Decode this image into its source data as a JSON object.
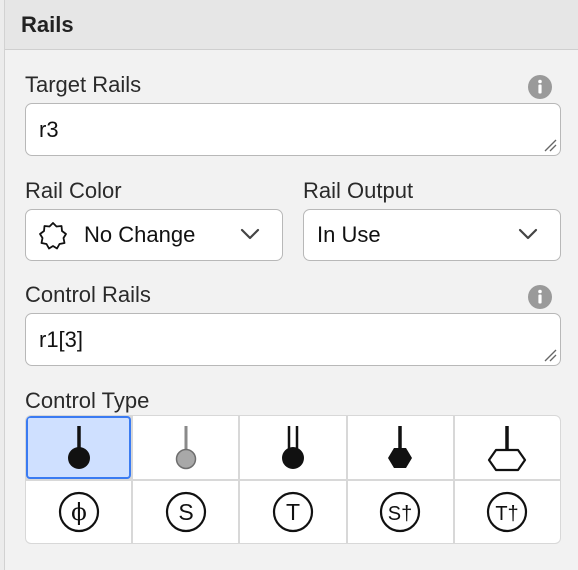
{
  "panel": {
    "title": "Rails"
  },
  "target_rails": {
    "label": "Target Rails",
    "value": "r3",
    "info_icon": "info-icon"
  },
  "rail_color": {
    "label": "Rail Color",
    "value": "No Change",
    "icon": "gear-badge-icon"
  },
  "rail_output": {
    "label": "Rail Output",
    "value": "In Use"
  },
  "control_rails": {
    "label": "Control Rails",
    "value": "r1[3]",
    "info_icon": "info-icon"
  },
  "control_type": {
    "label": "Control Type",
    "selected": "control-filled",
    "options": [
      {
        "id": "control-filled",
        "icon": "filled-control-icon"
      },
      {
        "id": "control-hollow-gray",
        "icon": "gray-control-icon"
      },
      {
        "id": "control-double-stem",
        "icon": "double-stem-control-icon"
      },
      {
        "id": "control-hexagon-filled",
        "icon": "filled-hexagon-icon"
      },
      {
        "id": "control-hexagon-outline",
        "icon": "outline-hexagon-icon"
      },
      {
        "id": "phase-gate",
        "icon": "phase-circle-icon",
        "symbol": "ϕ"
      },
      {
        "id": "s-gate",
        "icon": "s-circle-icon",
        "symbol": "S"
      },
      {
        "id": "t-gate",
        "icon": "t-circle-icon",
        "symbol": "T"
      },
      {
        "id": "s-dagger-gate",
        "icon": "s-dagger-circle-icon",
        "symbol": "S†"
      },
      {
        "id": "t-dagger-gate",
        "icon": "t-dagger-circle-icon",
        "symbol": "T†"
      }
    ]
  },
  "colors": {
    "selected_bg": "#cfe0ff",
    "selected_border": "#3a7bf2",
    "control_dark": "#111111",
    "control_gray": "#999999"
  }
}
